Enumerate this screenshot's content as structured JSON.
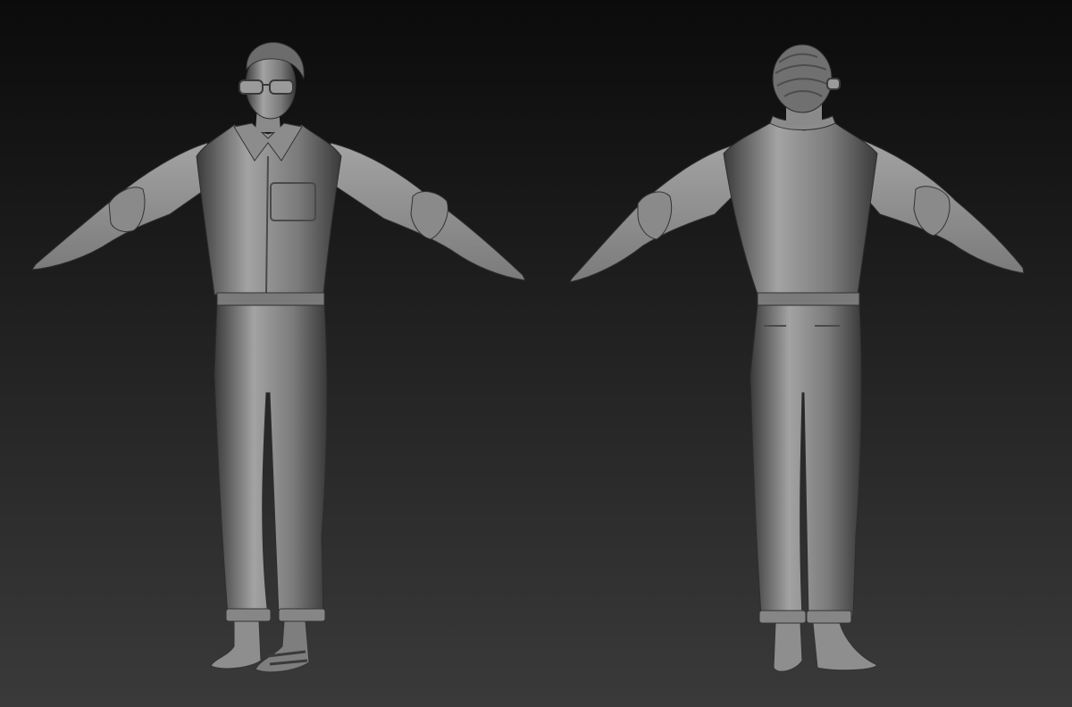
{
  "scene": {
    "background_top": "#0b0b0b",
    "background_bottom": "#3a3a3a",
    "sculpt_base": "#7b7b7b",
    "sculpt_highlight": "#a3a3a3",
    "sculpt_shadow": "#3a3a3a"
  },
  "figures": [
    {
      "view": "front"
    },
    {
      "view": "back"
    }
  ]
}
